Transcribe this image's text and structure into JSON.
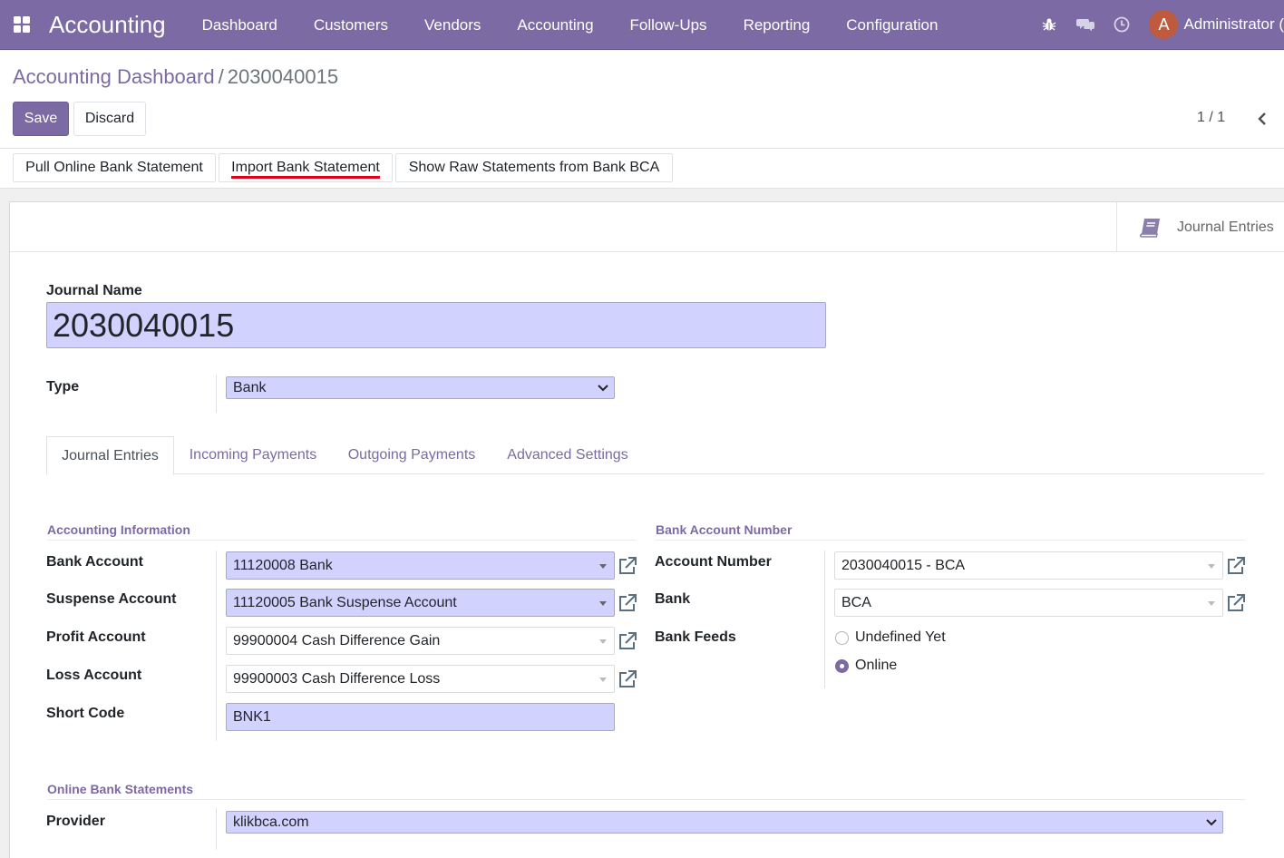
{
  "navbar": {
    "app_title": "Accounting",
    "menu": [
      "Dashboard",
      "Customers",
      "Vendors",
      "Accounting",
      "Follow-Ups",
      "Reporting",
      "Configuration"
    ],
    "avatar_initial": "A",
    "user_name": "Administrator ("
  },
  "breadcrumb": {
    "parent": "Accounting Dashboard",
    "separator": "/",
    "current": "2030040015"
  },
  "actions": {
    "save": "Save",
    "discard": "Discard",
    "pager": "1 / 1"
  },
  "statusbar": {
    "pull": "Pull Online Bank Statement",
    "import": "Import Bank Statement",
    "raw": "Show Raw Statements from Bank BCA"
  },
  "smart_button": {
    "journal_entries": "Journal Entries"
  },
  "form": {
    "journal_name_label": "Journal Name",
    "journal_name": "2030040015",
    "type_label": "Type",
    "type_value": "Bank"
  },
  "tabs": [
    "Journal Entries",
    "Incoming Payments",
    "Outgoing Payments",
    "Advanced Settings"
  ],
  "accounting_info": {
    "title": "Accounting Information",
    "bank_account_label": "Bank Account",
    "bank_account": "11120008 Bank",
    "suspense_label": "Suspense Account",
    "suspense": "11120005 Bank Suspense Account",
    "profit_label": "Profit Account",
    "profit": "99900004 Cash Difference Gain",
    "loss_label": "Loss Account",
    "loss": "99900003 Cash Difference Loss",
    "short_code_label": "Short Code",
    "short_code": "BNK1"
  },
  "bank_account_number": {
    "title": "Bank Account Number",
    "account_number_label": "Account Number",
    "account_number": "2030040015 - BCA",
    "bank_label": "Bank",
    "bank": "BCA",
    "feeds_label": "Bank Feeds",
    "feeds_options": [
      "Undefined Yet",
      "Online"
    ],
    "feeds_selected": "Online"
  },
  "online_statements": {
    "title": "Online Bank Statements",
    "provider_label": "Provider",
    "provider": "klikbca.com"
  },
  "colors": {
    "brand": "#7b6aa3",
    "required_field": "#d2d2ff",
    "highlight_underline": "#e3001b"
  }
}
